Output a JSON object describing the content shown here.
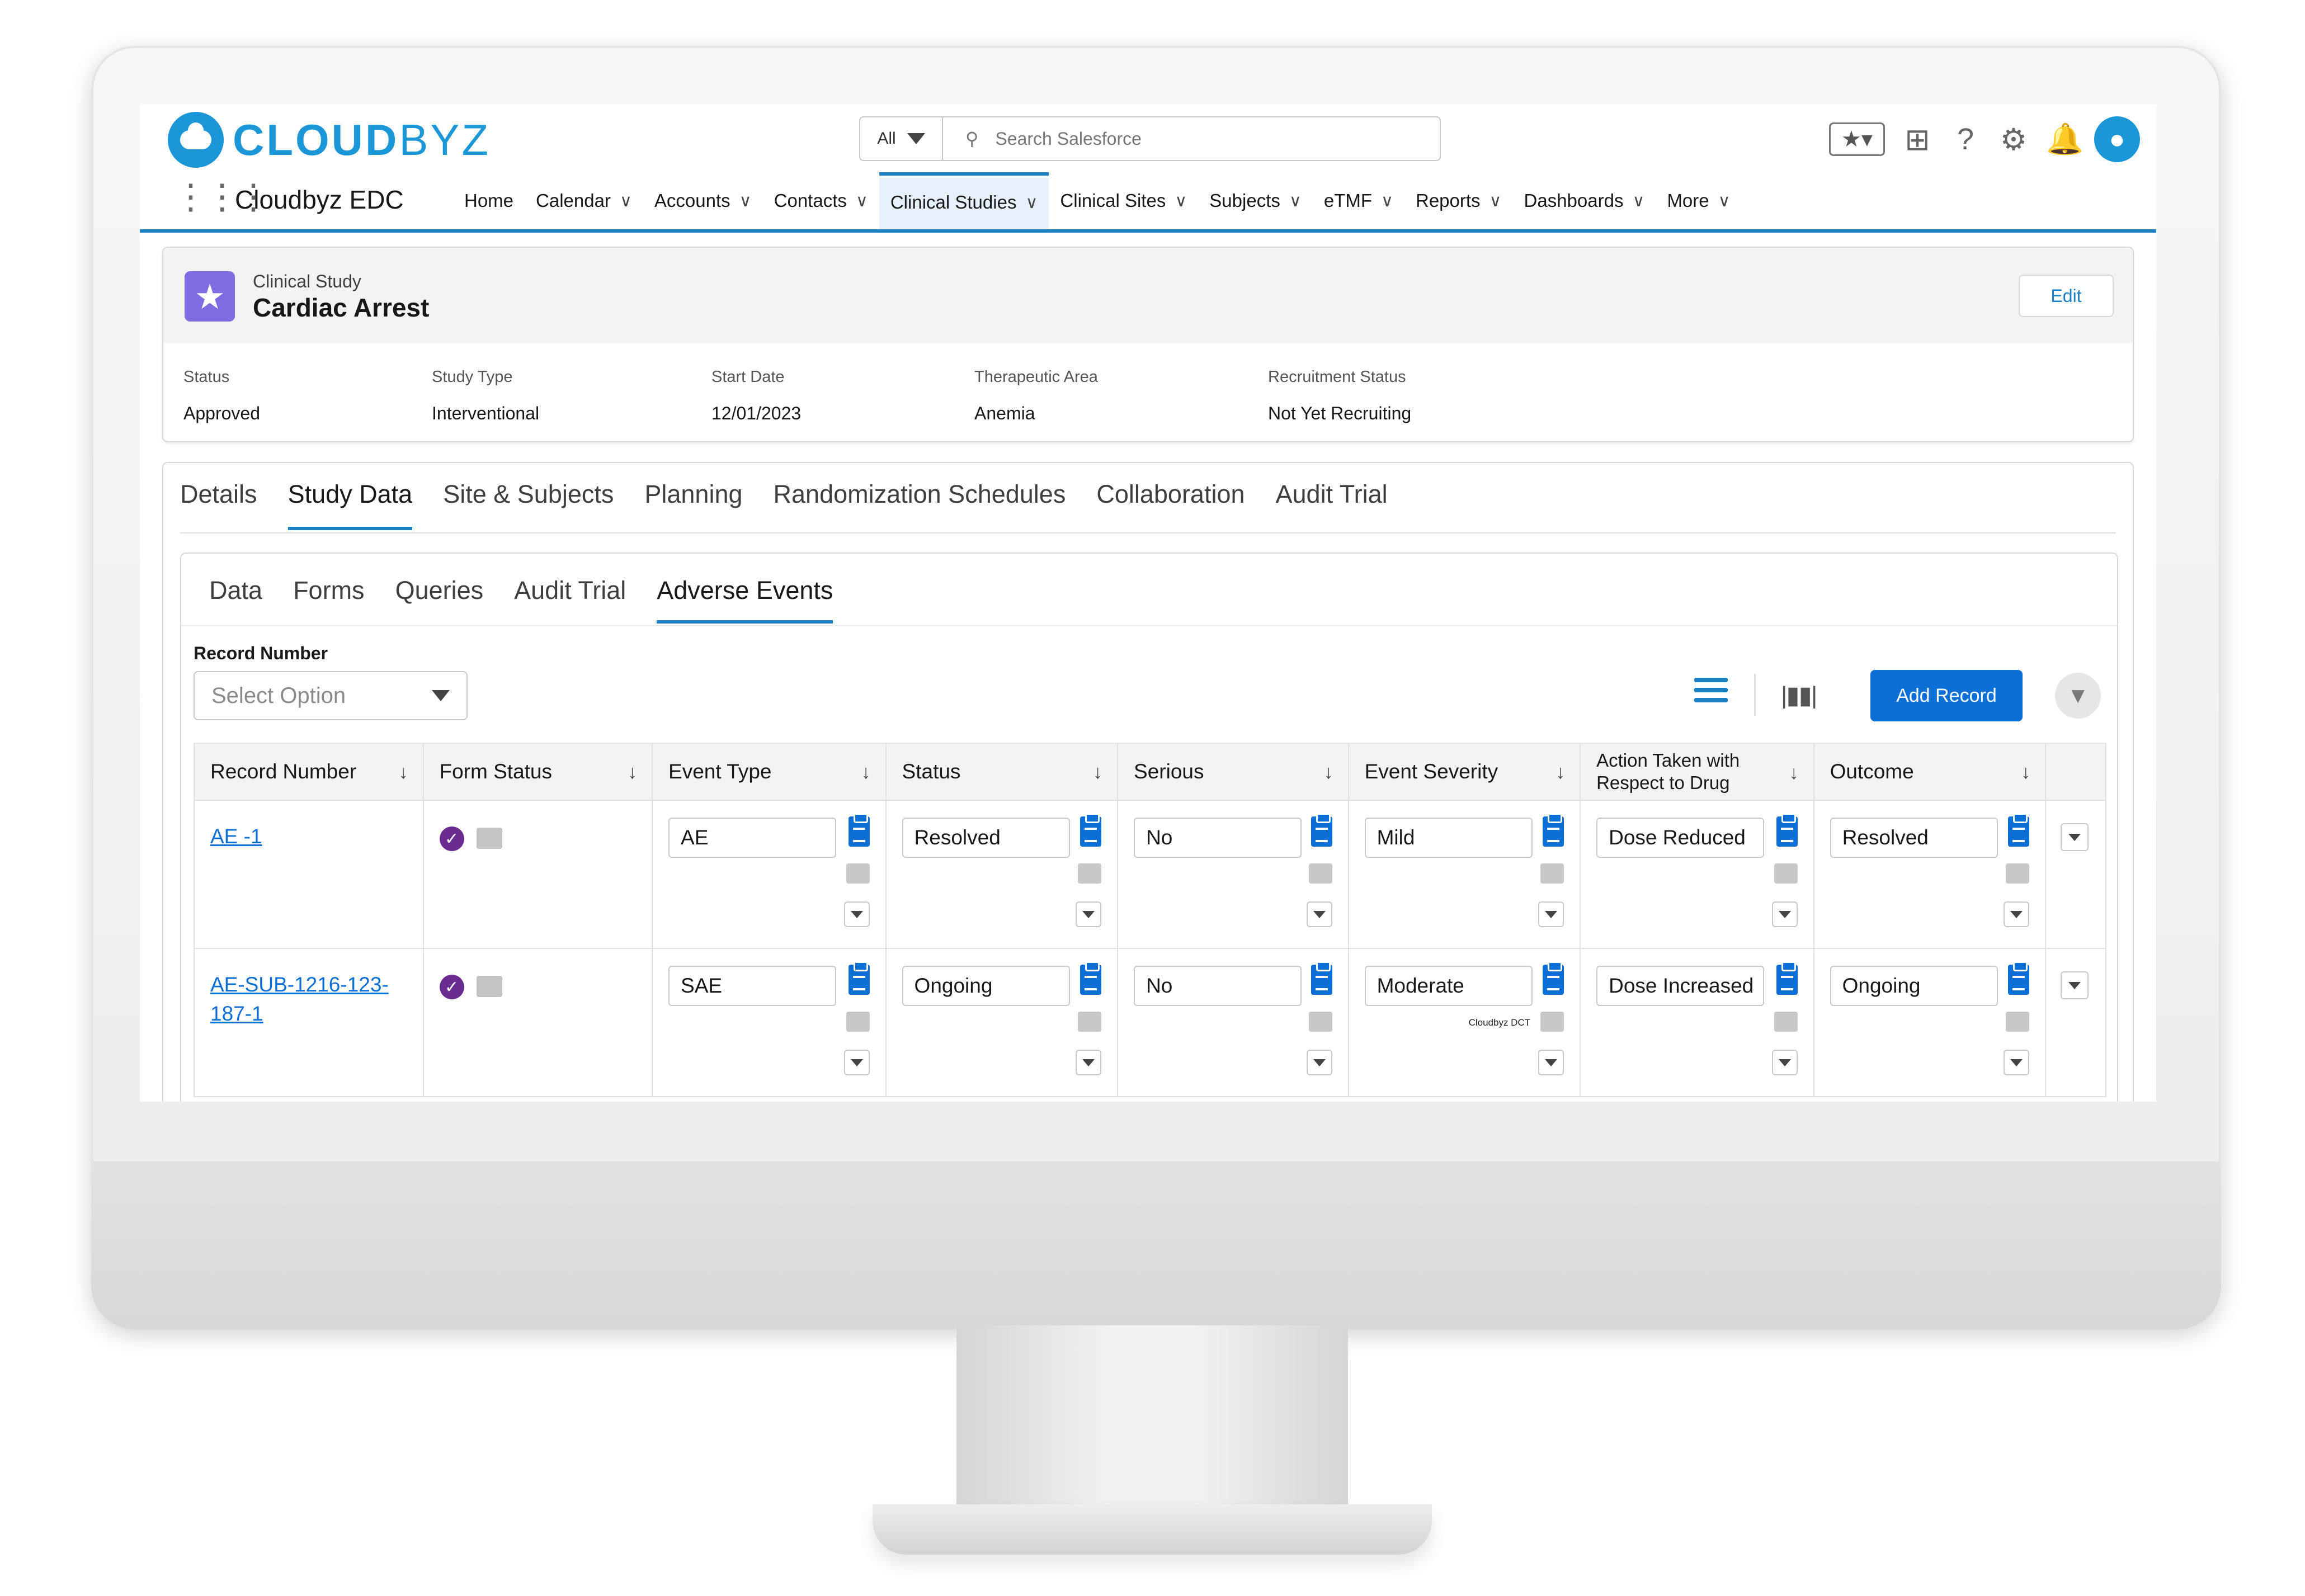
{
  "brand": {
    "logo_bold": "CLOUD",
    "logo_light": "BYZ",
    "app_name": "Cloudbyz EDC"
  },
  "search": {
    "scope": "All",
    "placeholder": "Search Salesforce"
  },
  "nav": [
    {
      "label": "Home",
      "dropdown": false
    },
    {
      "label": "Calendar",
      "dropdown": true
    },
    {
      "label": "Accounts",
      "dropdown": true
    },
    {
      "label": "Contacts",
      "dropdown": true
    },
    {
      "label": "Clinical Studies",
      "dropdown": true,
      "active": true
    },
    {
      "label": "Clinical Sites",
      "dropdown": true
    },
    {
      "label": "Subjects",
      "dropdown": true
    },
    {
      "label": "eTMF",
      "dropdown": true
    },
    {
      "label": "Reports",
      "dropdown": true
    },
    {
      "label": "Dashboards",
      "dropdown": true
    },
    {
      "label": "More",
      "dropdown": true
    }
  ],
  "record": {
    "object_type": "Clinical Study",
    "name": "Cardiac Arrest",
    "edit_label": "Edit",
    "fields": [
      {
        "label": "Status",
        "value": "Approved"
      },
      {
        "label": "Study Type",
        "value": "Interventional"
      },
      {
        "label": "Start Date",
        "value": "12/01/2023"
      },
      {
        "label": "Therapeutic Area",
        "value": "Anemia"
      },
      {
        "label": "Recruitment Status",
        "value": "Not Yet Recruiting"
      }
    ]
  },
  "tabs": [
    "Details",
    "Study Data",
    "Site & Subjects",
    "Planning",
    "Randomization Schedules",
    "Collaboration",
    "Audit Trial"
  ],
  "active_tab": "Study Data",
  "subtabs": [
    "Data",
    "Forms",
    "Queries",
    "Audit Trial",
    "Adverse Events"
  ],
  "active_subtab": "Adverse Events",
  "filter": {
    "label": "Record Number",
    "placeholder": "Select Option"
  },
  "toolbar": {
    "add_label": "Add Record"
  },
  "table": {
    "headers": [
      "Record Number",
      "Form Status",
      "Event Type",
      "Status",
      "Serious",
      "Event Severity",
      "Action Taken with Respect to Drug",
      "Outcome"
    ],
    "rows": [
      {
        "record": "AE -1",
        "event_type": "AE",
        "status": "Resolved",
        "serious": "No",
        "severity": "Mild",
        "action": "Dose Reduced",
        "outcome": "Resolved"
      },
      {
        "record": "AE-SUB-1216-123-187-1",
        "event_type": "SAE",
        "status": "Ongoing",
        "serious": "No",
        "severity": "Moderate",
        "action": "Dose Increased",
        "outcome": "Ongoing"
      }
    ]
  },
  "tooltip": "Cloudbyz DCT",
  "colors": {
    "brand_blue": "#1b96d6",
    "accent_blue": "#0b6fd6",
    "object_icon": "#7f6ce2",
    "form_status": "#6a2c91"
  }
}
